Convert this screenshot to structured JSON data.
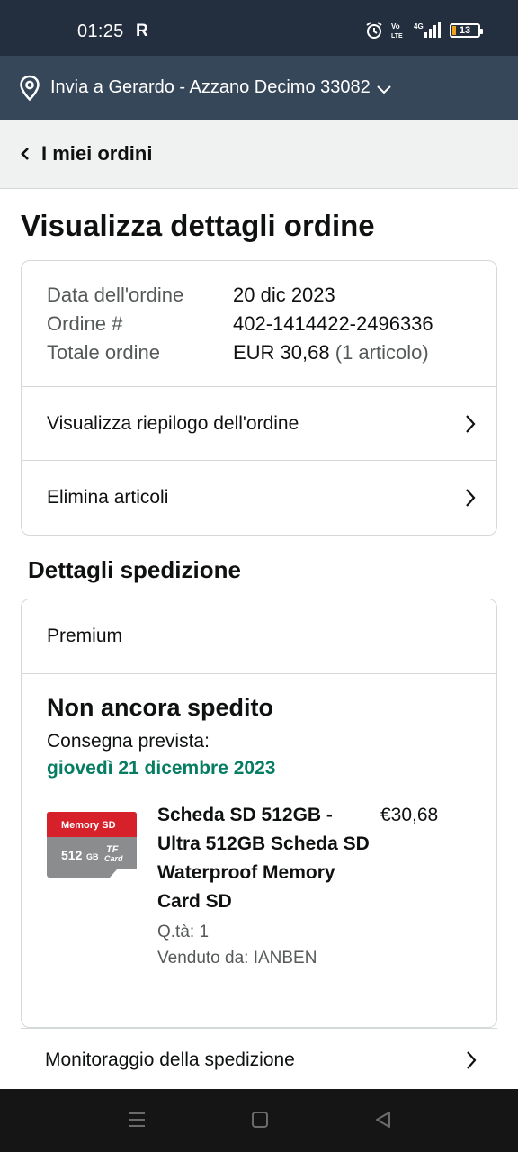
{
  "status": {
    "time": "01:25",
    "carrier_glyph": "R",
    "battery": "13",
    "network_label": "4G",
    "volte_label": "Vo LTE"
  },
  "address": {
    "text": "Invia a Gerardo - Azzano Decimo 33082"
  },
  "nav": {
    "back_label": "I miei ordini"
  },
  "page": {
    "title": "Visualizza dettagli ordine"
  },
  "order": {
    "date_label": "Data dell'ordine",
    "date_value": "20 dic 2023",
    "number_label": "Ordine #",
    "number_value": "402-1414422-2496336",
    "total_label": "Totale ordine",
    "total_value": "EUR 30,68",
    "total_items": "(1 articolo)"
  },
  "links": {
    "summary": "Visualizza riepilogo dell'ordine",
    "delete": "Elimina articoli"
  },
  "shipping": {
    "section_title": "Dettagli spedizione",
    "tier": "Premium",
    "status": "Non ancora spedito",
    "expected_label": "Consegna prevista:",
    "expected_date": "giovedì 21 dicembre 2023"
  },
  "item": {
    "name": "Scheda SD 512GB - Ultra 512GB Scheda SD Waterproof Memory Card SD",
    "quantity": "Q.tà: 1",
    "seller": "Venduto da: IANBEN",
    "price": "€30,68",
    "image_brand": "Memory SD",
    "image_capacity": "512",
    "image_capacity_unit": "GB",
    "image_type_top": "TF",
    "image_type_bottom": "Card"
  },
  "tracking": {
    "label": "Monitoraggio della spedizione"
  },
  "colors": {
    "header": "#232f3e",
    "subheader": "#37475a",
    "delivery_green": "#067d62",
    "card_red": "#d6202a",
    "card_gray": "#8a8c8e"
  },
  "icons": [
    "alarm-icon",
    "volte-icon",
    "signal-icon",
    "battery-icon",
    "location-pin-icon",
    "chevron-down-icon",
    "chevron-left-icon",
    "chevron-right-icon",
    "menu-icon",
    "home-icon",
    "back-icon"
  ]
}
